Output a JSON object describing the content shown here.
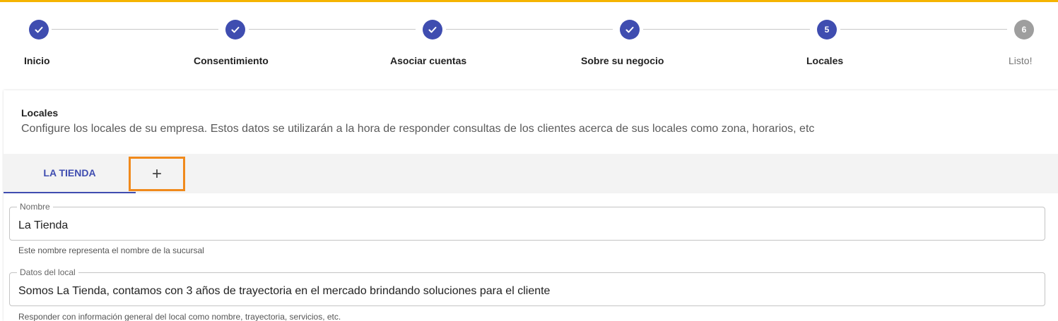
{
  "colors": {
    "accent": "#f5b400",
    "primary": "#3f4db0",
    "pending": "#9e9e9e",
    "highlight": "#f08a1c"
  },
  "stepper": {
    "steps": [
      {
        "label": "Inicio",
        "state": "done",
        "number": ""
      },
      {
        "label": "Consentimiento",
        "state": "done",
        "number": ""
      },
      {
        "label": "Asociar cuentas",
        "state": "done",
        "number": ""
      },
      {
        "label": "Sobre su negocio",
        "state": "done",
        "number": ""
      },
      {
        "label": "Locales",
        "state": "active",
        "number": "5"
      },
      {
        "label": "Listo!",
        "state": "pending",
        "number": "6"
      }
    ]
  },
  "section": {
    "title": "Locales",
    "description": "Configure los locales de su empresa. Estos datos se utilizarán a la hora de responder consultas de los clientes acerca de sus locales como zona, horarios, etc"
  },
  "tabs": {
    "items": [
      {
        "label": "LA TIENDA"
      }
    ],
    "add_label": "+",
    "add_icon": "plus-icon"
  },
  "form": {
    "nombre": {
      "label": "Nombre",
      "value": "La Tienda",
      "helper": "Este nombre representa el nombre de la sucursal"
    },
    "datos": {
      "label": "Datos del local",
      "value": "Somos La Tienda, contamos con 3 años de trayectoria en el mercado brindando soluciones para el cliente",
      "helper": "Responder con información general del local como nombre, trayectoria, servicios, etc."
    }
  }
}
